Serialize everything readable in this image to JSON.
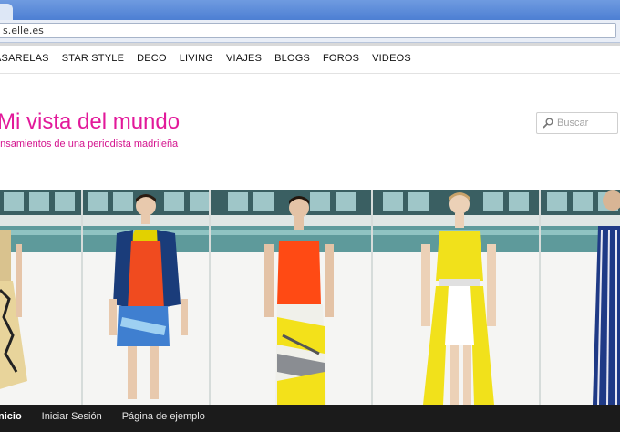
{
  "browser": {
    "address": "s.elle.es"
  },
  "site_nav": {
    "items": [
      {
        "label": "ASARELAS"
      },
      {
        "label": "STAR STYLE"
      },
      {
        "label": "DECO"
      },
      {
        "label": "LIVING"
      },
      {
        "label": "VIAJES"
      },
      {
        "label": "BLOGS"
      },
      {
        "label": "FOROS"
      },
      {
        "label": "VIDEOS"
      }
    ]
  },
  "blog": {
    "title": "Mi vista del mundo",
    "tagline": "ensamientos de una periodista madrileña"
  },
  "search": {
    "placeholder": "Buscar"
  },
  "bottom_nav": {
    "items": [
      {
        "label": "nicio"
      },
      {
        "label": "Iniciar Sesión"
      },
      {
        "label": "Página de ejemplo"
      }
    ]
  },
  "colors": {
    "brand_pink": "#e2199a",
    "chrome_blue": "#5a8ad8",
    "bottom_bar": "#1b1b1b"
  }
}
